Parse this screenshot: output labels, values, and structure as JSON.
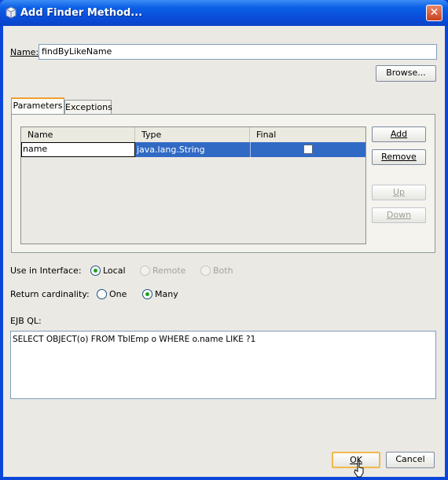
{
  "window": {
    "title": "Add Finder Method..."
  },
  "name_field": {
    "label": "Name:",
    "value": "findByLikeName"
  },
  "browse_button": "Browse...",
  "tabs": [
    {
      "label": "Parameters"
    },
    {
      "label": "Exceptions"
    }
  ],
  "table": {
    "columns": [
      "Name",
      "Type",
      "Final"
    ],
    "rows": [
      {
        "name": "name",
        "type": "java.lang.String",
        "final": false
      }
    ]
  },
  "side_buttons": {
    "add": "Add",
    "remove": "Remove",
    "up": "Up",
    "down": "Down"
  },
  "interface": {
    "label": "Use in Interface:",
    "options": [
      "Local",
      "Remote",
      "Both"
    ],
    "selected": "Local"
  },
  "cardinality": {
    "label": "Return cardinality:",
    "options": [
      "One",
      "Many"
    ],
    "selected": "Many"
  },
  "ejbql": {
    "label": "EJB QL:",
    "value": "SELECT OBJECT(o)  FROM TblEmp o WHERE o.name LIKE ?1"
  },
  "footer": {
    "ok": "OK",
    "cancel": "Cancel"
  },
  "colors": {
    "titlebar": "#0a4cd8",
    "selection": "#316ac5",
    "dialog_bg": "#ebe9e4"
  }
}
